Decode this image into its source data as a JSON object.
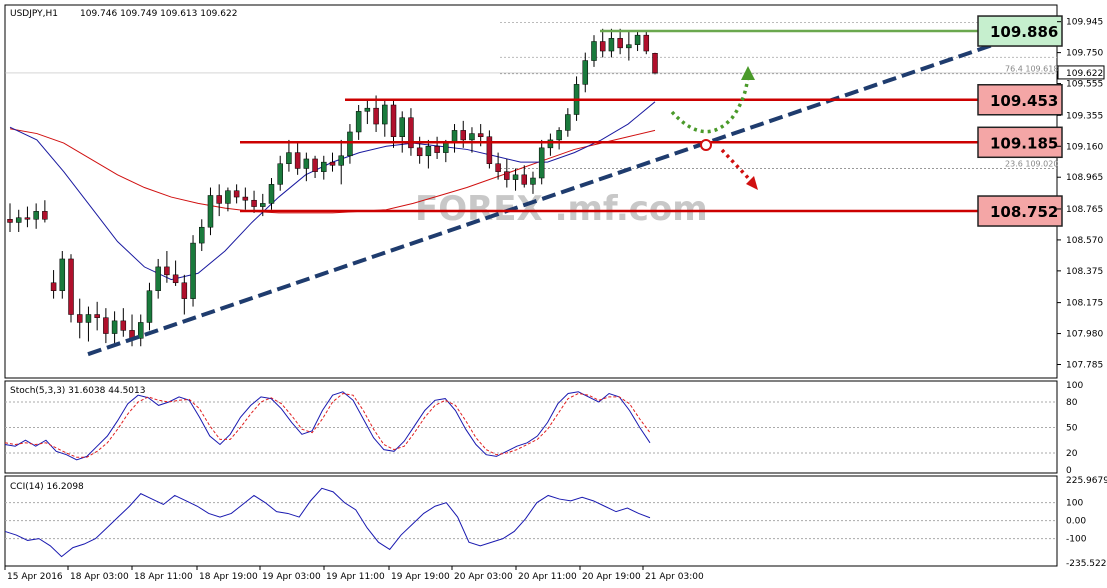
{
  "header": {
    "symbol": "USDJPY,H1",
    "ohlc": "109.746 109.749 109.613 109.622"
  },
  "chart_data": [
    {
      "type": "candlestick",
      "symbol": "USDJPY",
      "timeframe": "H1",
      "ylim": [
        107.7,
        110.05
      ],
      "y_ticks": [
        "109.945",
        "109.750",
        "109.555",
        "109.355",
        "109.160",
        "108.965",
        "108.765",
        "108.570",
        "108.375",
        "108.175",
        "107.980",
        "107.785"
      ],
      "x_ticks": [
        "15 Apr 2016",
        "18 Apr 03:00",
        "18 Apr 11:00",
        "18 Apr 19:00",
        "19 Apr 03:00",
        "19 Apr 11:00",
        "19 Apr 19:00",
        "20 Apr 03:00",
        "20 Apr 11:00",
        "20 Apr 19:00",
        "21 Apr 03:00"
      ],
      "current_price": "109.622",
      "price_levels": [
        {
          "label": "109.886",
          "value": 109.886,
          "kind": "resistance",
          "color": "#6aa84f",
          "fill": "#c6efce"
        },
        {
          "label": "109.453",
          "value": 109.453,
          "kind": "level",
          "color": "#cc0000",
          "fill": "#f4a6a6"
        },
        {
          "label": "109.185",
          "value": 109.185,
          "kind": "level",
          "color": "#cc0000",
          "fill": "#f4a6a6"
        },
        {
          "label": "108.752",
          "value": 108.752,
          "kind": "support",
          "color": "#cc0000",
          "fill": "#f4a6a6"
        }
      ],
      "fib_labels": [
        {
          "text": "76.4  109.618",
          "value": 109.618
        },
        {
          "text": "23.6  109.020",
          "value": 109.02
        }
      ],
      "trendline": {
        "from": {
          "bar": 2,
          "price": 107.85
        },
        "to": {
          "bar": 195,
          "price": 109.886
        },
        "color": "#1f3c6e"
      },
      "watermark": "FOREX .mf.com",
      "series": [
        {
          "name": "candles",
          "ohlc": [
            [
              108.7,
              108.8,
              108.62,
              108.68
            ],
            [
              108.68,
              108.76,
              108.62,
              108.71
            ],
            [
              108.71,
              108.78,
              108.65,
              108.7
            ],
            [
              108.7,
              108.8,
              108.64,
              108.75
            ],
            [
              108.75,
              108.82,
              108.68,
              108.7
            ],
            [
              108.3,
              108.38,
              108.2,
              108.25
            ],
            [
              108.25,
              108.5,
              108.2,
              108.45
            ],
            [
              108.45,
              108.48,
              108.05,
              108.1
            ],
            [
              108.1,
              108.2,
              107.95,
              108.05
            ],
            [
              108.05,
              108.15,
              107.93,
              108.1
            ],
            [
              108.1,
              108.18,
              108.0,
              108.08
            ],
            [
              108.08,
              108.14,
              107.92,
              107.98
            ],
            [
              107.98,
              108.12,
              107.9,
              108.06
            ],
            [
              108.06,
              108.14,
              107.96,
              108.0
            ],
            [
              108.0,
              108.1,
              107.9,
              107.95
            ],
            [
              107.95,
              108.1,
              107.9,
              108.05
            ],
            [
              108.05,
              108.3,
              108.0,
              108.25
            ],
            [
              108.25,
              108.45,
              108.2,
              108.4
            ],
            [
              108.4,
              108.5,
              108.3,
              108.35
            ],
            [
              108.35,
              108.44,
              108.28,
              108.3
            ],
            [
              108.3,
              108.35,
              108.1,
              108.2
            ],
            [
              108.2,
              108.6,
              108.15,
              108.55
            ],
            [
              108.55,
              108.7,
              108.5,
              108.65
            ],
            [
              108.65,
              108.9,
              108.6,
              108.85
            ],
            [
              108.85,
              108.92,
              108.72,
              108.8
            ],
            [
              108.8,
              108.9,
              108.75,
              108.88
            ],
            [
              108.88,
              108.92,
              108.8,
              108.84
            ],
            [
              108.84,
              108.9,
              108.76,
              108.82
            ],
            [
              108.82,
              108.88,
              108.74,
              108.78
            ],
            [
              108.78,
              108.86,
              108.72,
              108.8
            ],
            [
              108.8,
              108.96,
              108.76,
              108.92
            ],
            [
              108.92,
              109.1,
              108.88,
              109.05
            ],
            [
              109.05,
              109.2,
              109.0,
              109.12
            ],
            [
              109.12,
              109.18,
              108.98,
              109.02
            ],
            [
              109.02,
              109.12,
              108.94,
              109.08
            ],
            [
              109.08,
              109.1,
              108.96,
              109.0
            ],
            [
              109.0,
              109.1,
              108.95,
              109.06
            ],
            [
              109.06,
              109.12,
              109.0,
              109.04
            ],
            [
              109.04,
              109.2,
              108.92,
              109.1
            ],
            [
              109.1,
              109.3,
              109.05,
              109.25
            ],
            [
              109.25,
              109.42,
              109.2,
              109.38
            ],
            [
              109.38,
              109.46,
              109.3,
              109.4
            ],
            [
              109.4,
              109.48,
              109.25,
              109.3
            ],
            [
              109.3,
              109.46,
              109.22,
              109.42
            ],
            [
              109.42,
              109.46,
              109.15,
              109.22
            ],
            [
              109.22,
              109.38,
              109.12,
              109.34
            ],
            [
              109.34,
              109.4,
              109.1,
              109.15
            ],
            [
              109.15,
              109.22,
              109.05,
              109.1
            ],
            [
              109.1,
              109.2,
              109.02,
              109.16
            ],
            [
              109.16,
              109.22,
              109.08,
              109.12
            ],
            [
              109.12,
              109.2,
              109.06,
              109.18
            ],
            [
              109.18,
              109.3,
              109.12,
              109.26
            ],
            [
              109.26,
              109.32,
              109.15,
              109.2
            ],
            [
              109.2,
              109.28,
              109.12,
              109.24
            ],
            [
              109.24,
              109.3,
              109.16,
              109.22
            ],
            [
              109.22,
              109.26,
              109.02,
              109.05
            ],
            [
              109.05,
              109.12,
              108.95,
              109.0
            ],
            [
              109.0,
              109.08,
              108.9,
              108.95
            ],
            [
              108.95,
              109.02,
              108.88,
              108.98
            ],
            [
              108.98,
              109.04,
              108.9,
              108.92
            ],
            [
              108.92,
              109.0,
              108.86,
              108.96
            ],
            [
              108.96,
              109.2,
              108.92,
              109.15
            ],
            [
              109.15,
              109.24,
              109.1,
              109.2
            ],
            [
              109.2,
              109.28,
              109.14,
              109.26
            ],
            [
              109.26,
              109.4,
              109.22,
              109.36
            ],
            [
              109.36,
              109.6,
              109.32,
              109.55
            ],
            [
              109.55,
              109.75,
              109.5,
              109.7
            ],
            [
              109.7,
              109.86,
              109.66,
              109.82
            ],
            [
              109.82,
              109.9,
              109.72,
              109.76
            ],
            [
              109.76,
              109.9,
              109.72,
              109.84
            ],
            [
              109.84,
              109.9,
              109.74,
              109.78
            ],
            [
              109.78,
              109.88,
              109.7,
              109.8
            ],
            [
              109.8,
              109.89,
              109.76,
              109.86
            ],
            [
              109.86,
              109.89,
              109.74,
              109.76
            ],
            [
              109.746,
              109.749,
              109.613,
              109.622
            ]
          ]
        },
        {
          "name": "ma_slow",
          "values": [
            109.27,
            109.24,
            109.18,
            109.08,
            108.98,
            108.9,
            108.84,
            108.8,
            108.77,
            108.75,
            108.74,
            108.74,
            108.74,
            108.75,
            108.76,
            108.8,
            108.85,
            108.9,
            108.96,
            109.02,
            109.08,
            109.14,
            109.18,
            109.22,
            109.26
          ]
        },
        {
          "name": "ma_fast",
          "values": [
            109.28,
            109.2,
            109.0,
            108.78,
            108.56,
            108.4,
            108.32,
            108.36,
            108.5,
            108.68,
            108.84,
            108.98,
            109.06,
            109.12,
            109.16,
            109.18,
            109.16,
            109.14,
            109.1,
            109.06,
            109.06,
            109.12,
            109.2,
            109.3,
            109.44
          ]
        }
      ]
    },
    {
      "type": "line",
      "name": "Stoch(5,3,3) 31.6038 44.5013",
      "ylim": [
        0,
        100
      ],
      "y_ticks": [
        "100",
        "80",
        "50",
        "20",
        "0"
      ],
      "series": [
        {
          "name": "main",
          "values": [
            30,
            28,
            35,
            28,
            35,
            22,
            18,
            12,
            16,
            28,
            40,
            58,
            78,
            88,
            85,
            76,
            80,
            86,
            82,
            62,
            40,
            30,
            42,
            62,
            76,
            86,
            84,
            72,
            56,
            42,
            46,
            70,
            88,
            92,
            82,
            60,
            38,
            24,
            22,
            34,
            52,
            70,
            82,
            84,
            70,
            48,
            30,
            18,
            16,
            22,
            28,
            32,
            40,
            56,
            78,
            90,
            92,
            86,
            80,
            90,
            86,
            70,
            50,
            32
          ]
        },
        {
          "name": "signal",
          "values": [
            32,
            30,
            32,
            30,
            32,
            26,
            20,
            15,
            15,
            22,
            32,
            48,
            66,
            80,
            86,
            82,
            80,
            82,
            83,
            72,
            52,
            36,
            36,
            50,
            66,
            80,
            85,
            78,
            64,
            48,
            44,
            60,
            80,
            90,
            88,
            70,
            48,
            30,
            24,
            28,
            44,
            62,
            76,
            82,
            76,
            58,
            38,
            24,
            18,
            20,
            24,
            30,
            36,
            48,
            66,
            84,
            90,
            88,
            82,
            86,
            86,
            78,
            60,
            44
          ]
        }
      ]
    },
    {
      "type": "line",
      "name": "CCI(14) 16.2098",
      "ylim": [
        -235.5224,
        225.9679
      ],
      "y_ticks": [
        "225.9679",
        "100",
        "0.00",
        "-100",
        "-235.5224"
      ],
      "series": [
        {
          "name": "cci",
          "values": [
            -60,
            -80,
            -110,
            -100,
            -140,
            -200,
            -150,
            -130,
            -100,
            -40,
            20,
            80,
            150,
            120,
            90,
            140,
            110,
            80,
            40,
            20,
            40,
            90,
            140,
            100,
            50,
            40,
            20,
            110,
            180,
            160,
            100,
            60,
            -40,
            -120,
            -160,
            -80,
            -20,
            40,
            80,
            100,
            20,
            -120,
            -140,
            -120,
            -100,
            -60,
            10,
            100,
            140,
            120,
            110,
            130,
            110,
            80,
            50,
            70,
            40,
            16
          ]
        }
      ]
    }
  ]
}
